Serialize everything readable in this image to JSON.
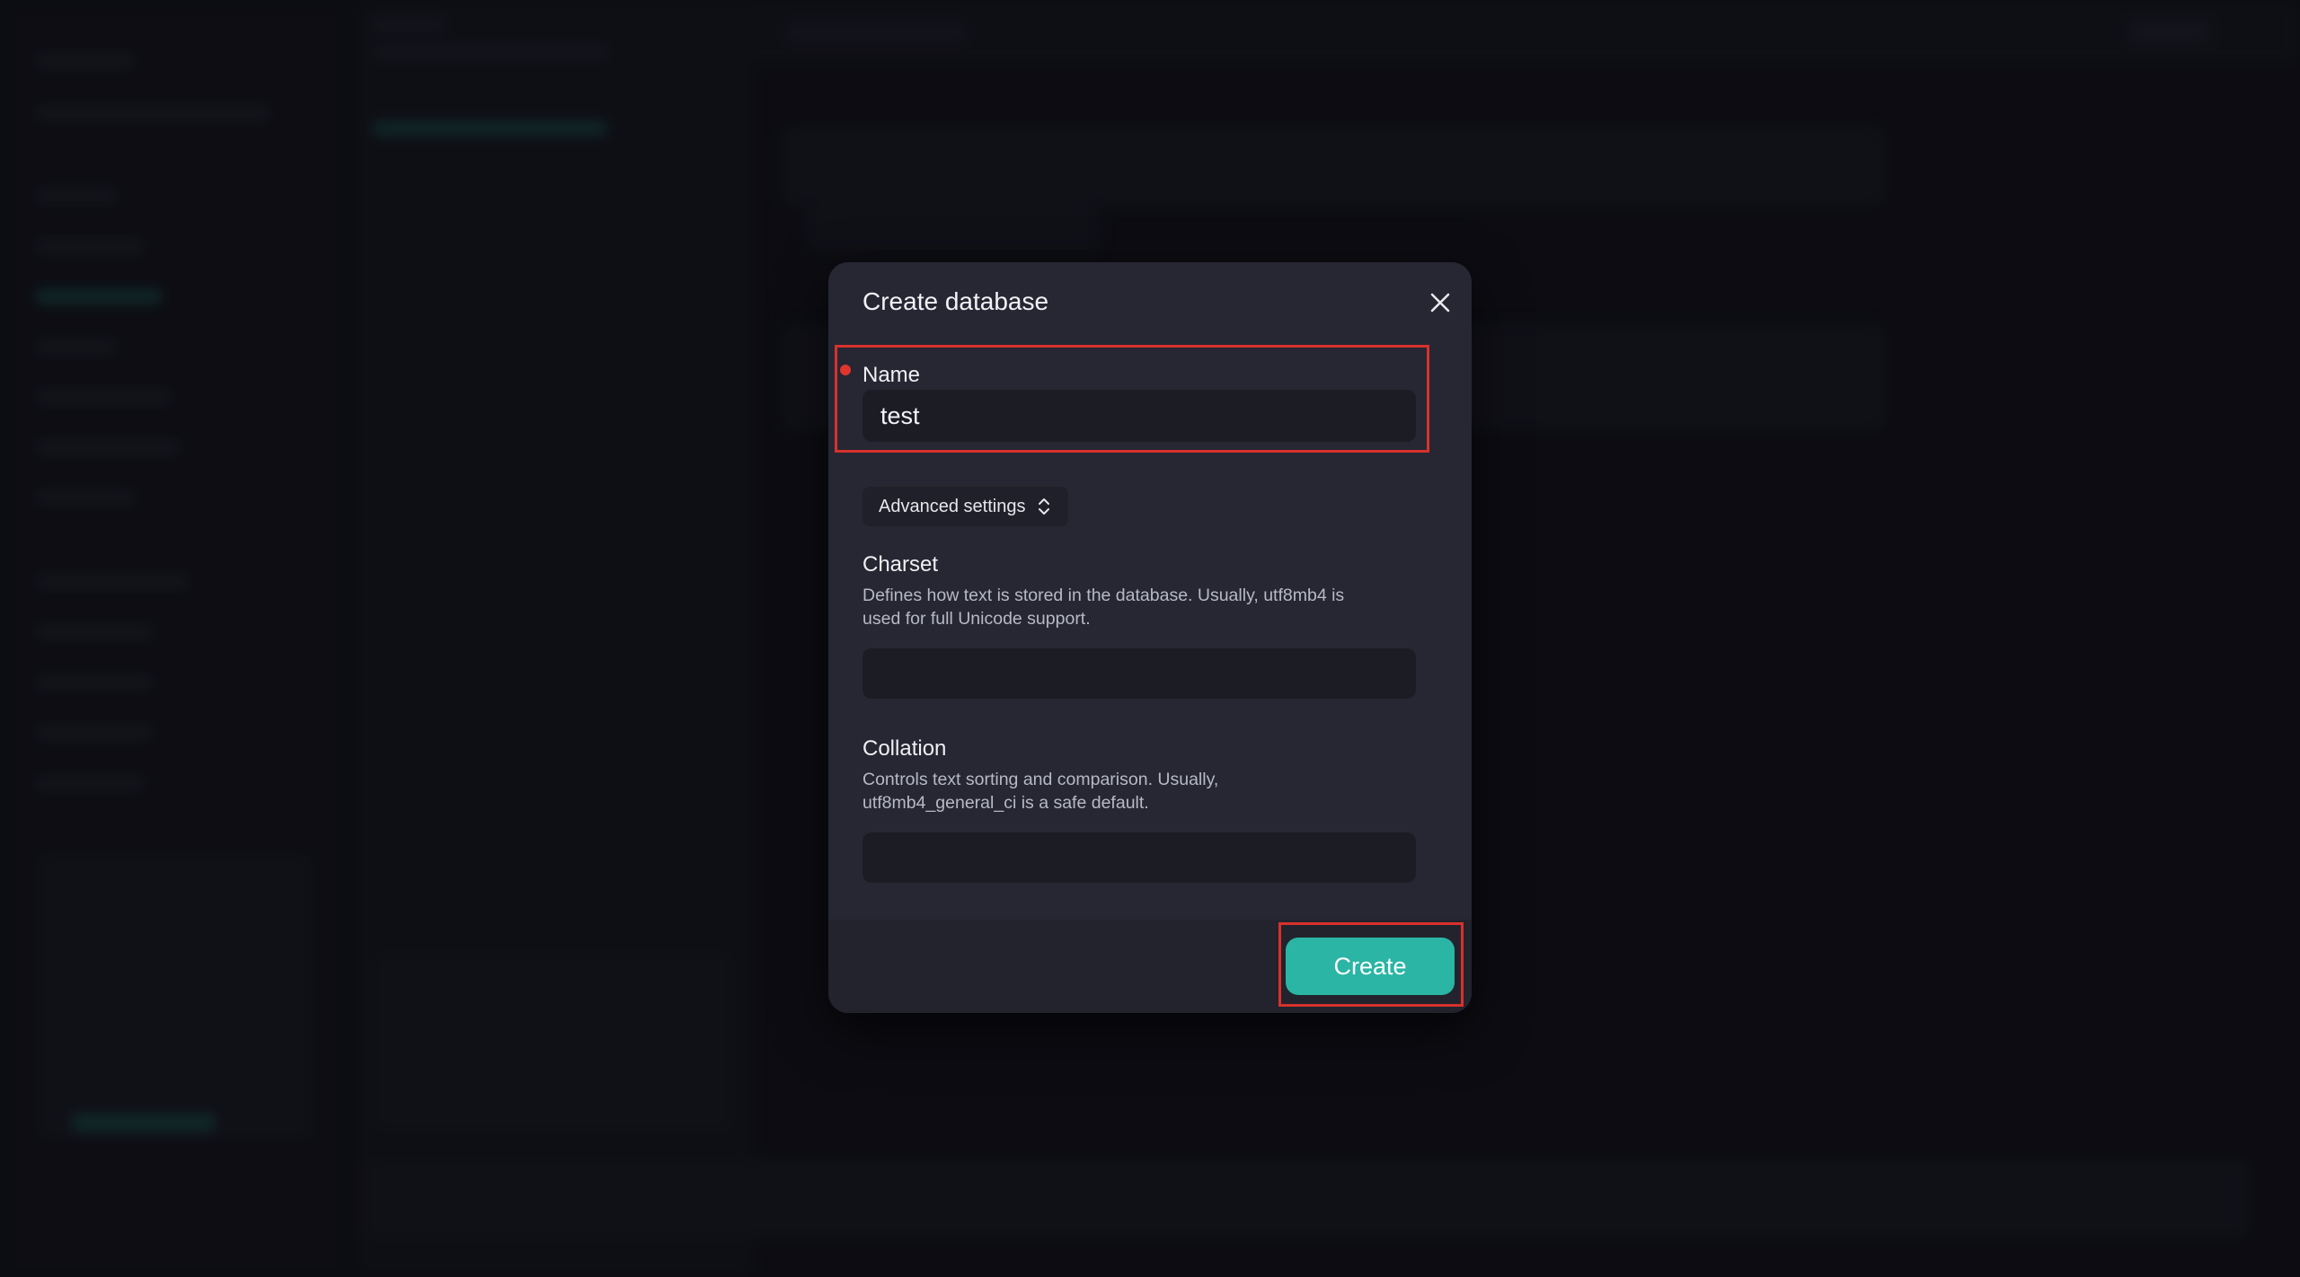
{
  "dialog": {
    "title": "Create database",
    "name_label": "Name",
    "name_value": "test",
    "advanced_label": "Advanced settings",
    "charset_label": "Charset",
    "charset_desc": "Defines how text is stored in the database. Usually, utf8mb4 is used for full Unicode support.",
    "charset_value": "",
    "collation_label": "Collation",
    "collation_desc": "Controls text sorting and comparison. Usually, utf8mb4_general_ci is a safe default.",
    "collation_value": "",
    "create_label": "Create"
  },
  "colors": {
    "accent": "#2ab5a4",
    "highlight": "#d8312c",
    "required_dot": "#e0352d",
    "modal_bg": "#262733"
  },
  "icons": {
    "close": "close-icon",
    "advanced": "chevron-up-down-icon"
  }
}
